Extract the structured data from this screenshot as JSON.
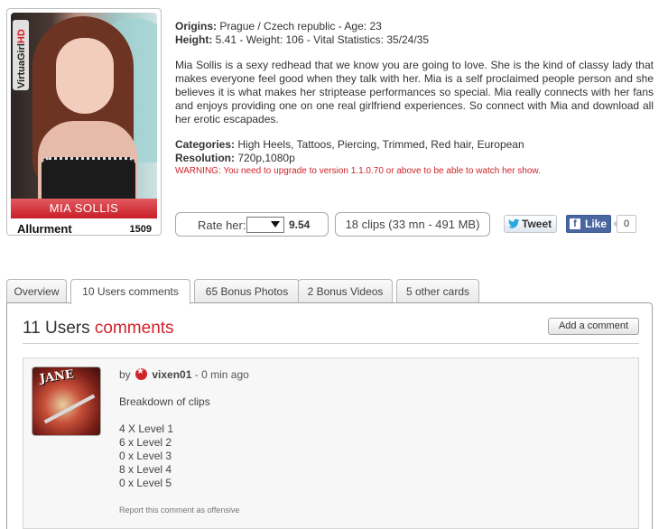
{
  "card": {
    "brand_prefix": "VirtuaGirl",
    "brand_suffix": "HD",
    "name": "MIA SOLLIS",
    "studio": "Allurment",
    "number": "1509"
  },
  "info": {
    "origins_label": "Origins:",
    "origins_value": "Prague / Czech republic - Age: 23",
    "height_label": "Height:",
    "height_value": "5.41 - Weight: 106 - Vital Statistics: 35/24/35",
    "bio": "Mia Sollis is a sexy redhead that we know you are going to love. She is the kind of classy lady that makes everyone feel good when they talk with her. Mia is a self proclaimed people person and she believes it is what makes her striptease performances so special. Mia really connects with her fans and enjoys providing one on one real girlfriend experiences. So connect with Mia and download all her erotic escapades.",
    "categories_label": "Categories:",
    "categories_value": "High Heels, Tattoos, Piercing, Trimmed, Red hair, European",
    "resolution_label": "Resolution:",
    "resolution_value": "720p,1080p",
    "warning": "WARNING: You need to upgrade to version 1.1.0.70 or above to be able to watch her show."
  },
  "actions": {
    "rate_label": "Rate her:",
    "rate_score": "9.54",
    "clips": "18 clips (33 mn - 491 MB)",
    "tweet": "Tweet",
    "like": "Like",
    "like_count": "0"
  },
  "tabs": [
    {
      "label": "Overview"
    },
    {
      "label": "10 Users comments",
      "active": true
    },
    {
      "label": "65 Bonus Photos"
    },
    {
      "label": "2 Bonus Videos"
    },
    {
      "label": "5 other cards"
    }
  ],
  "comments": {
    "title_count": "11 Users",
    "title_word": "comments",
    "add_button": "Add a comment",
    "items": [
      {
        "by": "by",
        "user": "vixen01",
        "time": "- 0 min ago",
        "avatar_text": "JANE",
        "body_heading": "Breakdown of clips",
        "lines": [
          "4 X Level 1",
          "6 x Level 2",
          "0 x Level 3",
          "8 x Level 4",
          "0 x Level 5"
        ],
        "report": "Report this comment as offensive"
      }
    ]
  },
  "colors": {
    "accent_red": "#d0232a",
    "facebook_blue": "#4a66a0",
    "twitter_blue": "#2aa9e0"
  }
}
